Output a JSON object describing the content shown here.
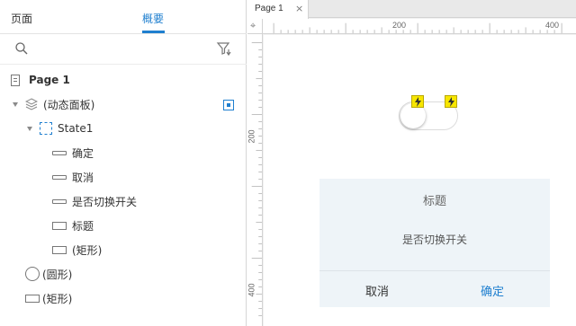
{
  "left_panel": {
    "tabs": {
      "pages": "页面",
      "outline": "概要"
    },
    "search": {
      "placeholder": ""
    },
    "tree": {
      "page": "Page 1",
      "dynamic_panel": "(动态面板)",
      "state": "State1",
      "items": [
        "确定",
        "取消",
        "是否切换开关",
        "标题",
        "(矩形)"
      ],
      "circle": "(圆形)",
      "rect": "(矩形)"
    }
  },
  "editor": {
    "tab_label": "Page 1",
    "tab_close": "×",
    "ruler": {
      "h_200": "200",
      "h_400": "400",
      "v_200": "200",
      "v_400": "400"
    }
  },
  "canvas": {
    "dialog": {
      "title": "标题",
      "message": "是否切换开关",
      "cancel": "取消",
      "confirm": "确定"
    }
  },
  "colors": {
    "accent": "#1f7fcf",
    "bolt": "#f7e600",
    "dialog_bg": "#eef4f8"
  }
}
